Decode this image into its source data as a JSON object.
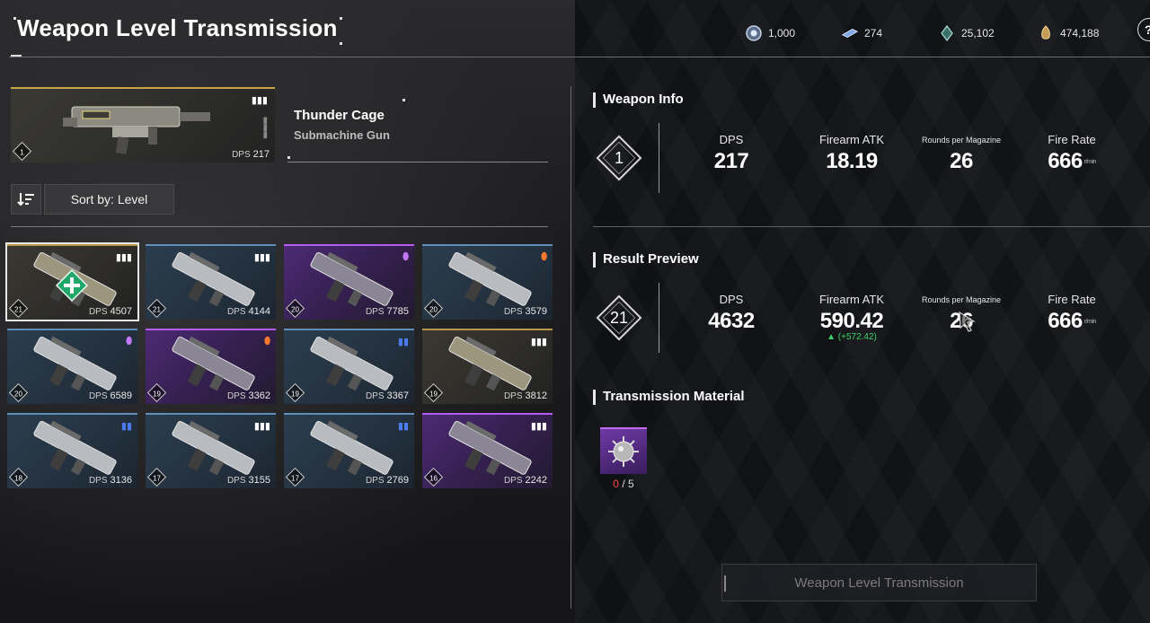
{
  "title": "Weapon Level Transmission",
  "currencies": [
    {
      "icon": "crystal-icon",
      "value": "1,000"
    },
    {
      "icon": "ticket-icon",
      "value": "274"
    },
    {
      "icon": "shard-icon",
      "value": "25,102"
    },
    {
      "icon": "gold-icon",
      "value": "474,188"
    }
  ],
  "help_label": "?",
  "selected_weapon": {
    "name": "Thunder Cage",
    "type": "Submachine Gun",
    "level": "1",
    "dps_label": "DPS",
    "dps": "217"
  },
  "sort": {
    "label": "Sort by: Level"
  },
  "weapons": [
    {
      "level": "21",
      "dps_label": "DPS",
      "dps": "4507",
      "rarity": "gold",
      "ammo": "general-ammo-icon",
      "selected": true
    },
    {
      "level": "21",
      "dps_label": "DPS",
      "dps": "4144",
      "rarity": "blue",
      "ammo": "general-ammo-icon"
    },
    {
      "level": "20",
      "dps_label": "DPS",
      "dps": "7785",
      "rarity": "purple",
      "ammo": "special-ammo-icon"
    },
    {
      "level": "20",
      "dps_label": "DPS",
      "dps": "3579",
      "rarity": "blue",
      "ammo": "high-power-ammo-icon"
    },
    {
      "level": "20",
      "dps_label": "DPS",
      "dps": "6589",
      "rarity": "blue",
      "ammo": "special-ammo-icon"
    },
    {
      "level": "19",
      "dps_label": "DPS",
      "dps": "3362",
      "rarity": "purple",
      "ammo": "high-power-ammo-icon"
    },
    {
      "level": "19",
      "dps_label": "DPS",
      "dps": "3367",
      "rarity": "blue",
      "ammo": "impact-ammo-icon"
    },
    {
      "level": "19",
      "dps_label": "DPS",
      "dps": "3812",
      "rarity": "gold",
      "ammo": "general-ammo-icon"
    },
    {
      "level": "18",
      "dps_label": "DPS",
      "dps": "3136",
      "rarity": "blue",
      "ammo": "impact-ammo-icon"
    },
    {
      "level": "17",
      "dps_label": "DPS",
      "dps": "3155",
      "rarity": "blue",
      "ammo": "general-ammo-icon"
    },
    {
      "level": "17",
      "dps_label": "DPS",
      "dps": "2769",
      "rarity": "blue",
      "ammo": "impact-ammo-icon"
    },
    {
      "level": "16",
      "dps_label": "DPS",
      "dps": "2242",
      "rarity": "purple",
      "ammo": "general-ammo-icon"
    }
  ],
  "weapon_info": {
    "title": "Weapon Info",
    "level": "1",
    "stats": [
      {
        "label": "DPS",
        "value": "217"
      },
      {
        "label": "Firearm ATK",
        "value": "18.19"
      },
      {
        "label": "Rounds per Magazine",
        "value": "26"
      },
      {
        "label": "Fire Rate",
        "value": "666",
        "unit": "r/min"
      }
    ]
  },
  "result_preview": {
    "title": "Result Preview",
    "level": "21",
    "stats": [
      {
        "label": "DPS",
        "value": "4632"
      },
      {
        "label": "Firearm ATK",
        "value": "590.42",
        "delta": "▲ (+572.42)"
      },
      {
        "label": "Rounds per Magazine",
        "value": "26"
      },
      {
        "label": "Fire Rate",
        "value": "666",
        "unit": "r/min"
      }
    ]
  },
  "material": {
    "title": "Transmission Material",
    "current": "0",
    "separator": " / ",
    "required": "5"
  },
  "action_button": "Weapon Level Transmission",
  "colors": {
    "gold": "#c9a34a",
    "blue": "#5f8fb8",
    "purple": "#b35cf0",
    "positive": "#3ad16a",
    "insufficient": "#ff4a4a",
    "plus_badge": "#1fa86a"
  }
}
